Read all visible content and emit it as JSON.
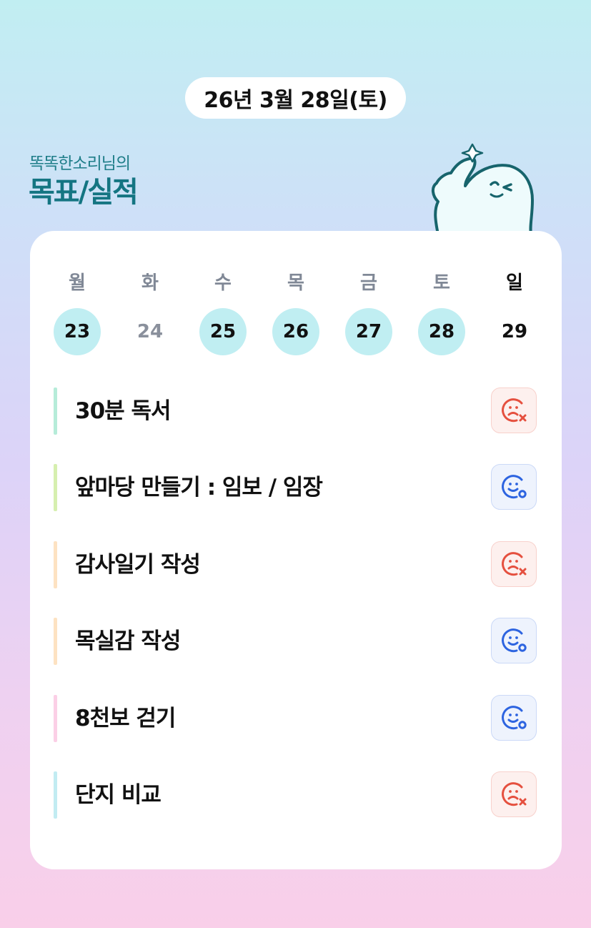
{
  "header": {
    "date": "26년 3월 28일(토)",
    "owner": "똑똑한소리님의",
    "title": "목표/실적"
  },
  "week": [
    {
      "weekday": "월",
      "date": "23",
      "state": "checked"
    },
    {
      "weekday": "화",
      "date": "24",
      "state": "unchecked"
    },
    {
      "weekday": "수",
      "date": "25",
      "state": "checked"
    },
    {
      "weekday": "목",
      "date": "26",
      "state": "checked"
    },
    {
      "weekday": "금",
      "date": "27",
      "state": "checked"
    },
    {
      "weekday": "토",
      "date": "28",
      "state": "checked"
    },
    {
      "weekday": "일",
      "date": "29",
      "state": "plain"
    }
  ],
  "goals": [
    {
      "label": "30분 독서",
      "status": "fail",
      "status_icon": "sad-face-x-icon",
      "bar_color": "#b6ecd9"
    },
    {
      "label": "앞마당 만들기 : 임보 / 임장",
      "status": "done",
      "status_icon": "smile-face-o-icon",
      "bar_color": "#d6efaf"
    },
    {
      "label": "감사일기 작성",
      "status": "fail",
      "status_icon": "sad-face-x-icon",
      "bar_color": "#fde2c2"
    },
    {
      "label": "목실감 작성",
      "status": "done",
      "status_icon": "smile-face-o-icon",
      "bar_color": "#fde2c2"
    },
    {
      "label": "8천보 걷기",
      "status": "done",
      "status_icon": "smile-face-o-icon",
      "bar_color": "#fbcfe6"
    },
    {
      "label": "단지 비교",
      "status": "fail",
      "status_icon": "sad-face-x-icon",
      "bar_color": "#c2ecf2"
    }
  ],
  "colors": {
    "accent": "#147582",
    "checked_day": "#c0eef2",
    "fail": "#e5503f",
    "done": "#2d64e0"
  }
}
